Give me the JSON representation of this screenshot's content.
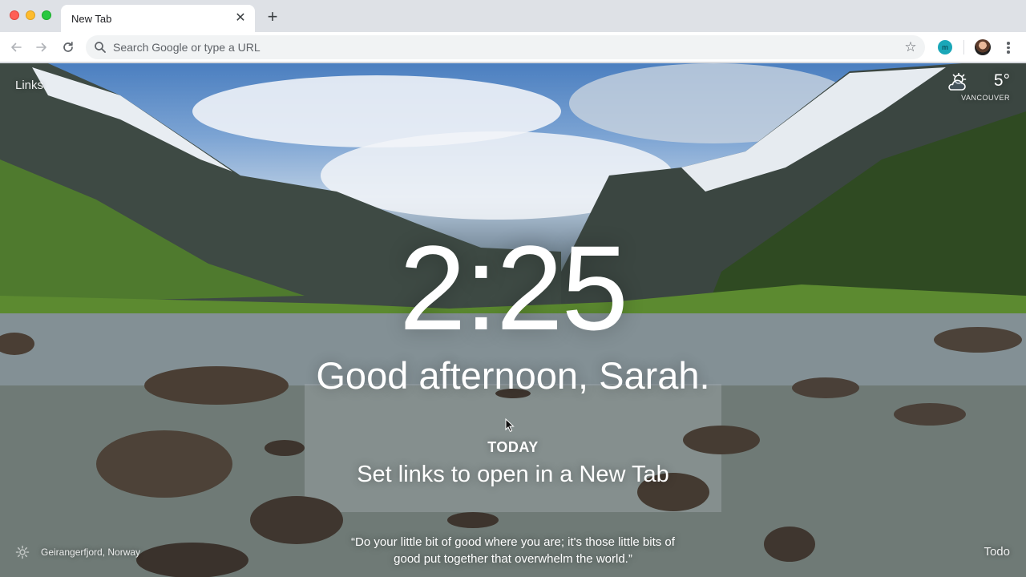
{
  "window": {
    "controls": [
      "close",
      "minimize",
      "zoom"
    ]
  },
  "tabs": [
    {
      "title": "New Tab",
      "close_icon": "close-icon"
    }
  ],
  "new_tab_symbol": "+",
  "toolbar": {
    "back_icon": "arrow-left-icon",
    "forward_icon": "arrow-right-icon",
    "reload_icon": "reload-icon",
    "omnibox_placeholder": "Search Google or type a URL",
    "bookmark_icon": "star-icon",
    "extension_label": "m",
    "profile_icon": "avatar",
    "menu_icon": "kebab-menu-icon"
  },
  "momentum": {
    "links_label": "Links",
    "weather": {
      "icon": "partly-cloudy-icon",
      "temperature": "5°",
      "city": "VANCOUVER"
    },
    "clock": "2:25",
    "greeting": "Good afternoon, Sarah.",
    "focus_label": "TODAY",
    "focus_text": "Set links to open in a New Tab",
    "quote": "“Do your little bit of good where you are; it's those little bits of good put together that overwhelm the world.”",
    "photo_location": "Geirangerfjord, Norway",
    "todo_label": "Todo"
  },
  "colors": {
    "tabstrip": "#dee1e6",
    "toolbar": "#ffffff",
    "omnibox": "#f1f3f4",
    "accent_extension": "#1aa7b8"
  }
}
